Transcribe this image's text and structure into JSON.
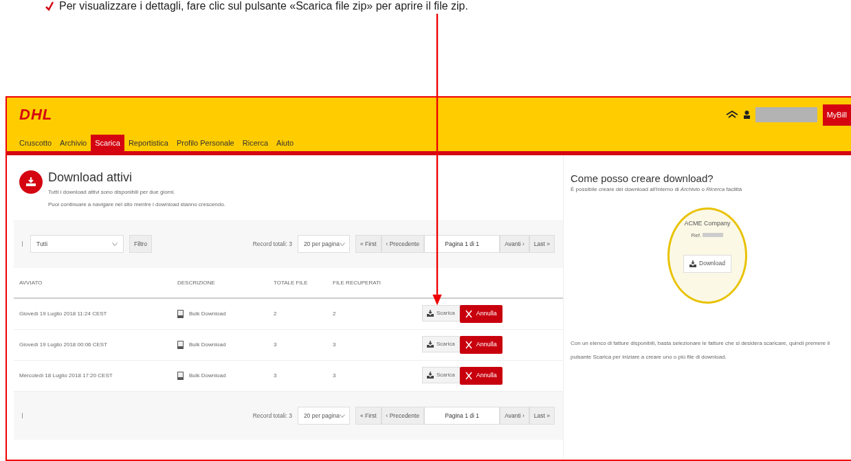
{
  "instruction": "Per visualizzare i dettagli, fare clic sul pulsante «Scarica file zip» per aprire il file zip.",
  "header": {
    "logo": "DHL",
    "badge": "MyBill"
  },
  "nav": [
    {
      "label": "Cruscotto",
      "selected": false
    },
    {
      "label": "Archivio",
      "selected": false
    },
    {
      "label": "Scarica",
      "selected": true
    },
    {
      "label": "Reportistica",
      "selected": false
    },
    {
      "label": "Profilo Personale",
      "selected": false
    },
    {
      "label": "Ricerca",
      "selected": false
    },
    {
      "label": "Aiuto",
      "selected": false
    }
  ],
  "page": {
    "title": "Download attivi",
    "lines": [
      "Tutti i download attivi sono disponibili per due giorni.",
      "Puoi continuare a navigare nel sito mentre i download stanno crescendo."
    ]
  },
  "toolbar_top": {
    "filter_value": "Tutti",
    "filter_button": "Filtro",
    "records": "Record totali: 3",
    "per_page": "20 per pagina",
    "first": "« First",
    "prev": "‹ Precedente",
    "page": "Pagina 1 di 1",
    "next": "Avanti ›",
    "last": "Last »"
  },
  "table": {
    "columns": [
      "AVVIATO",
      "DESCRIZIONE",
      "TOTALE FILE",
      "FILE RECUPERATI"
    ],
    "rows": [
      {
        "started": "Giovedì 19 Luglio 2018 11:24 CEST",
        "description": "Bulk Download",
        "total": "2",
        "retrieved": "2",
        "download": "Scarica",
        "cancel": "Annulla"
      },
      {
        "started": "Giovedì 19 Luglio 2018 00:06 CEST",
        "description": "Bulk Download",
        "total": "3",
        "retrieved": "3",
        "download": "Scarica",
        "cancel": "Annulla"
      },
      {
        "started": "Mercoledì 18 Luglio 2018 17:20 CEST",
        "description": "Bulk Download",
        "total": "3",
        "retrieved": "3",
        "download": "Scarica",
        "cancel": "Annulla"
      }
    ]
  },
  "toolbar_bottom": {
    "records": "Record totali: 3",
    "per_page": "20 per pagina",
    "first": "« First",
    "prev": "‹ Precedente",
    "page": "Pagina 1 di 1",
    "next": "Avanti ›",
    "last": "Last »"
  },
  "help": {
    "title": "Come posso creare download?",
    "intro": "È possibile creare dei download all'interno di *Archivio* o *Ricerca* facilità",
    "company": "ACME Company",
    "ref": "Ref.",
    "download": "Download",
    "body": "Con un elenco di fatture disponibili, basta selezionare le fatture che si desidera scaricare, quindi premere il pulsante Scarica per iniziare a creare uno o più file di download."
  }
}
